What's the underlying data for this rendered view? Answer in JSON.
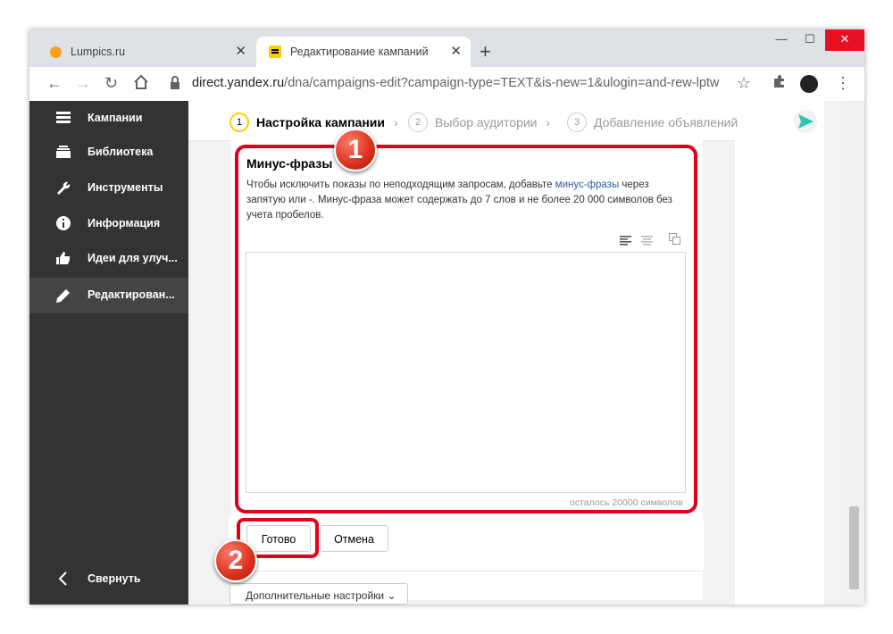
{
  "browser": {
    "tabs": [
      {
        "title": "Lumpics.ru",
        "active": false
      },
      {
        "title": "Редактирование кампаний",
        "active": true
      }
    ],
    "new_tab": "+",
    "url_host": "direct.yandex.ru",
    "url_path": "/dna/campaigns-edit?campaign-type=TEXT&is-new=1&ulogin=and-rew-lptw",
    "window_controls": {
      "minimize": "—",
      "maximize": "☐",
      "close": "✕"
    }
  },
  "sidebar": {
    "items": [
      {
        "label": "Кампании",
        "icon": "campaigns-icon"
      },
      {
        "label": "Библиотека",
        "icon": "library-icon"
      },
      {
        "label": "Инструменты",
        "icon": "wrench-icon"
      },
      {
        "label": "Информация",
        "icon": "info-icon"
      },
      {
        "label": "Идеи для улуч...",
        "icon": "thumbs-up-icon"
      },
      {
        "label": "Редактирован...",
        "icon": "pencil-icon",
        "active": true
      }
    ],
    "collapse_label": "Свернуть"
  },
  "steps": [
    {
      "num": "1",
      "label": "Настройка кампании",
      "active": true
    },
    {
      "num": "2",
      "label": "Выбор аудитории",
      "active": false
    },
    {
      "num": "3",
      "label": "Добавление объявлений",
      "active": false
    }
  ],
  "minus_phrases": {
    "title": "Минус-фразы",
    "desc_before": "Чтобы исключить показы по неподходящим запросам, добавьте ",
    "desc_link": "минус-фразы",
    "desc_after": " через запятую или -. Минус-фраза может содержать до 7 слов и не более 20 000 символов без учета пробелов.",
    "textarea_value": "",
    "counter": "осталось 20000 символов"
  },
  "buttons": {
    "done": "Готово",
    "cancel": "Отмена"
  },
  "extra_settings": "Дополнительные настройки",
  "annotations": {
    "badge1": "1",
    "badge2": "2"
  },
  "colors": {
    "accent_red": "#e0001b",
    "sidebar_bg": "#333333",
    "step_active": "#ffcc00",
    "link": "#2a5d9f"
  }
}
